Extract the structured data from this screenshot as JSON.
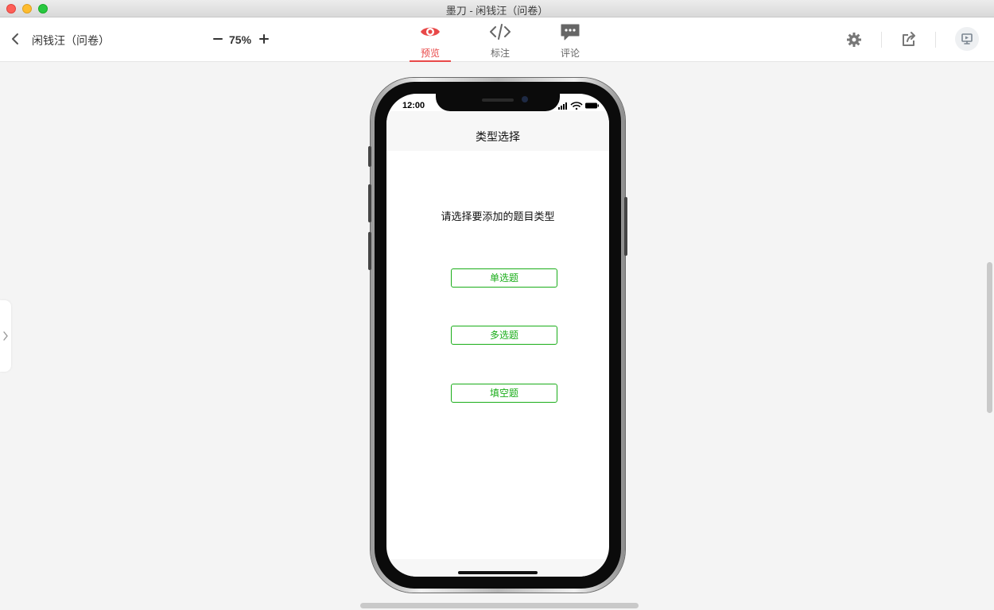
{
  "window": {
    "title": "墨刀 - 闲钱汪（问卷）"
  },
  "toolbar": {
    "project_name": "闲钱汪（问卷）",
    "zoom": {
      "minus": "−",
      "value": "75%",
      "plus": "+"
    },
    "tabs": [
      {
        "label": "预览",
        "icon": "eye-icon",
        "active": true
      },
      {
        "label": "标注",
        "icon": "code-icon",
        "active": false
      },
      {
        "label": "评论",
        "icon": "comment-icon",
        "active": false
      }
    ],
    "accent_color": "#e84848"
  },
  "phone": {
    "status_time": "12:00",
    "nav_title": "类型选择",
    "prompt": "请选择要添加的题目类型",
    "options": [
      "单选题",
      "多选题",
      "填空题"
    ],
    "option_color": "#1aad19"
  }
}
